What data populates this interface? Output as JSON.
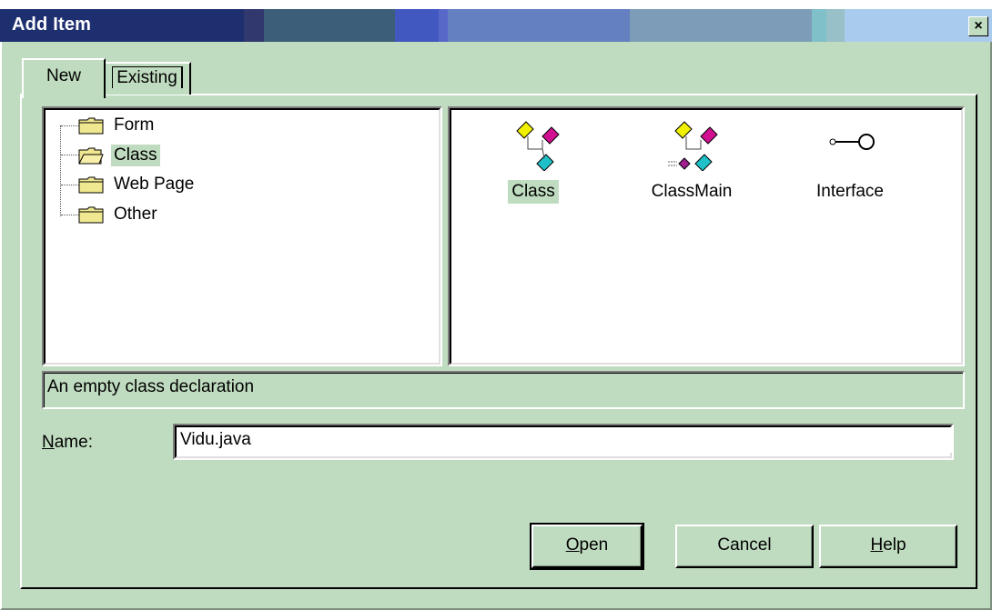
{
  "window": {
    "title": "Add Item",
    "close_glyph": "×"
  },
  "tabs": [
    {
      "label": "New",
      "active": true
    },
    {
      "label": "Existing",
      "active": false
    }
  ],
  "tree": {
    "items": [
      {
        "label": "Form",
        "icon": "folder-closed-icon",
        "selected": false
      },
      {
        "label": "Class",
        "icon": "folder-open-icon",
        "selected": true
      },
      {
        "label": "Web Page",
        "icon": "folder-closed-icon",
        "selected": false
      },
      {
        "label": "Other",
        "icon": "folder-closed-icon",
        "selected": false
      }
    ]
  },
  "templates": [
    {
      "label": "Class",
      "icon": "class-icon",
      "selected": true
    },
    {
      "label": "ClassMain",
      "icon": "class-main-icon",
      "selected": false
    },
    {
      "label": "Interface",
      "icon": "interface-icon",
      "selected": false
    }
  ],
  "description": "An empty class declaration",
  "name_field": {
    "label_mnemonic": "N",
    "label_rest": "ame:",
    "value": "Vidu.java"
  },
  "buttons": {
    "open": {
      "mnemonic": "O",
      "rest": "pen"
    },
    "cancel": {
      "label": "Cancel"
    },
    "help": {
      "mnemonic": "H",
      "rest": "elp"
    }
  },
  "colors": {
    "dialog_bg": "#c0dcc0",
    "title_start": "#1c2f6e",
    "title_end": "#a8cbe8"
  }
}
